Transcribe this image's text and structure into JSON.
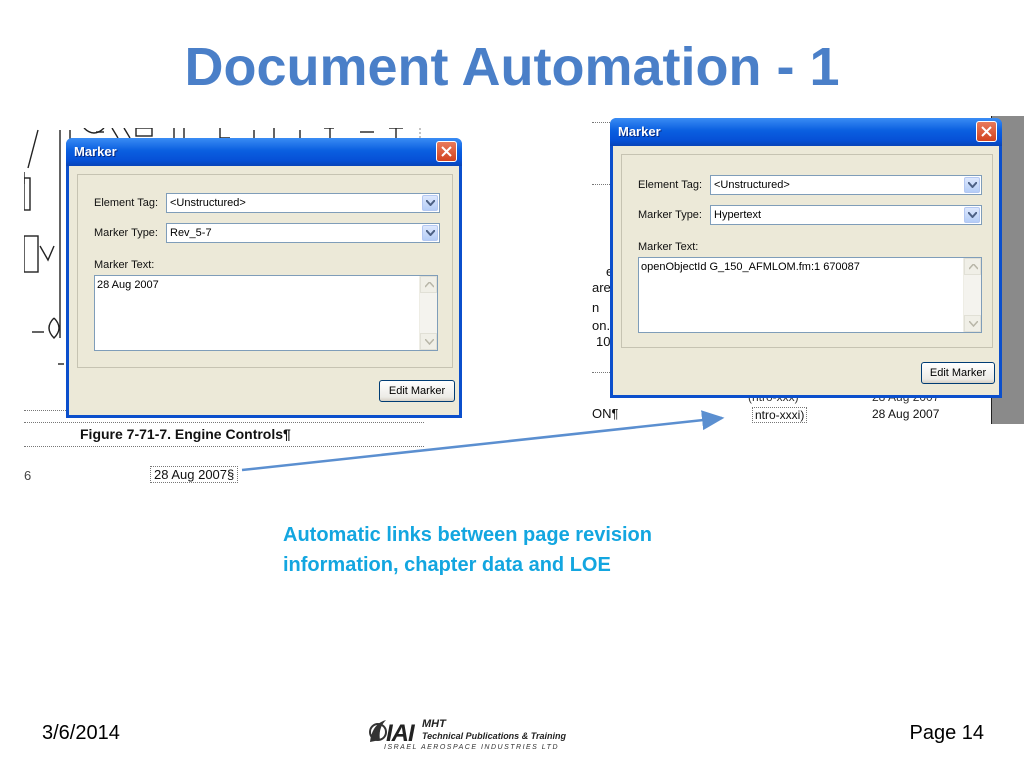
{
  "slide": {
    "title": "Document Automation - 1",
    "caption_line1": "Automatic links between page revision",
    "caption_line2": "information, chapter data and LOE",
    "footer_date": "3/6/2014",
    "footer_page": "Page 14"
  },
  "logo": {
    "brand": "IAI",
    "line1": "MHT",
    "line2": "Technical Publications & Training",
    "line3": "ISRAEL AEROSPACE INDUSTRIES LTD"
  },
  "doc_left": {
    "figure_caption": "Figure 7-71-7. Engine Controls¶",
    "date_marker": "28 Aug 2007§",
    "margin_number": "6"
  },
  "doc_right": {
    "row1_left": "ON¶",
    "row1_ref": "(ntro-xxx)",
    "row1_date": "28  Aug  2007",
    "row2_ref": "ntro-xxxi)",
    "row2_date": "28  Aug  2007",
    "fragments": [
      "e",
      "are",
      "n",
      "on.",
      "10"
    ]
  },
  "dialog_left": {
    "title": "Marker",
    "element_tag_label": "Element Tag:",
    "element_tag_value": "<Unstructured>",
    "marker_type_label": "Marker Type:",
    "marker_type_value": "Rev_5-7",
    "marker_text_label": "Marker Text:",
    "marker_text_value": "28 Aug 2007",
    "button_label": "Edit Marker"
  },
  "dialog_right": {
    "title": "Marker",
    "element_tag_label": "Element Tag:",
    "element_tag_value": "<Unstructured>",
    "marker_type_label": "Marker Type:",
    "marker_type_value": "Hypertext",
    "marker_text_label": "Marker Text:",
    "marker_text_value": "openObjectId G_150_AFMLOM.fm:1 670087",
    "button_label": "Edit Marker"
  },
  "icons": [
    "close-icon",
    "dropdown-arrow-icon",
    "scroll-up-icon",
    "scroll-down-icon",
    "link-arrow-icon",
    "iai-logo-icon"
  ],
  "colors": {
    "title": "#4a7fc8",
    "caption": "#13a6e0",
    "xp_titlebar": "#0a5fe0",
    "dialog_face": "#ece9d8",
    "arrow": "#5b8fd0"
  }
}
